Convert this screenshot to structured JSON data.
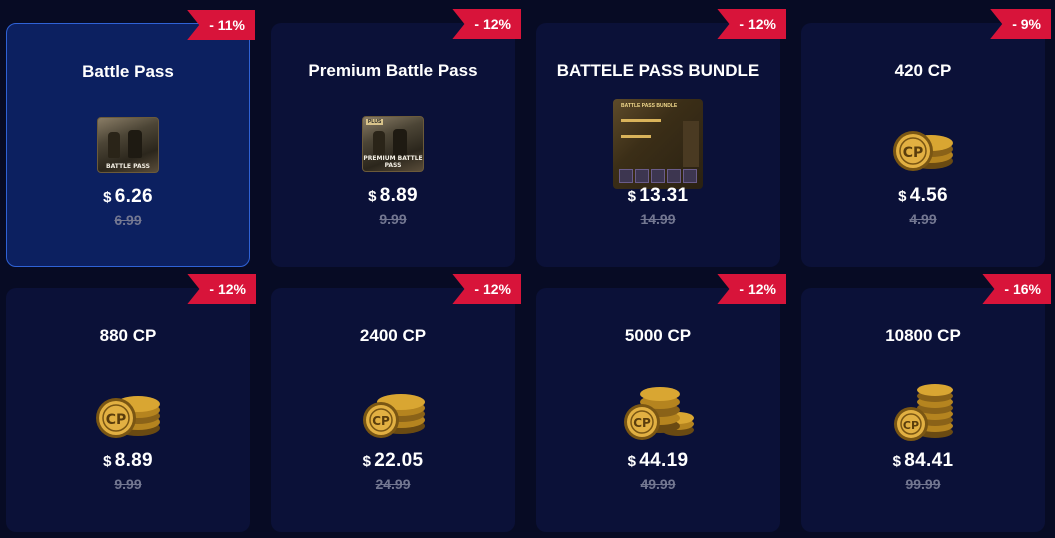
{
  "products": [
    {
      "title": "Battle Pass",
      "discount": "- 11%",
      "currency": "$",
      "price": "6.26",
      "old_price": "6.99",
      "icon": "battle-pass-image",
      "selected": true,
      "thumb_caption": "BATTLE PASS"
    },
    {
      "title": "Premium Battle Pass",
      "discount": "- 12%",
      "currency": "$",
      "price": "8.89",
      "old_price": "9.99",
      "icon": "premium-battle-pass-image",
      "selected": false,
      "thumb_caption": "PREMIUM BATTLE PASS",
      "thumb_tag": "PLUS"
    },
    {
      "title": "BATTELE PASS BUNDLE",
      "discount": "- 12%",
      "currency": "$",
      "price": "13.31",
      "old_price": "14.99",
      "icon": "battle-pass-bundle-image",
      "selected": false,
      "thumb_caption": "BATTLE PASS BUNDLE"
    },
    {
      "title": "420 CP",
      "discount": "- 9%",
      "currency": "$",
      "price": "4.56",
      "old_price": "4.99",
      "icon": "cp-coins-icon",
      "selected": false,
      "coin_label": "CP"
    },
    {
      "title": "880 CP",
      "discount": "- 12%",
      "currency": "$",
      "price": "8.89",
      "old_price": "9.99",
      "icon": "cp-coins-icon",
      "selected": false,
      "coin_label": "CP"
    },
    {
      "title": "2400 CP",
      "discount": "- 12%",
      "currency": "$",
      "price": "22.05",
      "old_price": "24.99",
      "icon": "cp-coins-icon",
      "selected": false,
      "coin_label": "CP"
    },
    {
      "title": "5000 CP",
      "discount": "- 12%",
      "currency": "$",
      "price": "44.19",
      "old_price": "49.99",
      "icon": "cp-coins-icon",
      "selected": false,
      "coin_label": "CP"
    },
    {
      "title": "10800 CP",
      "discount": "- 16%",
      "currency": "$",
      "price": "84.41",
      "old_price": "99.99",
      "icon": "cp-coins-icon",
      "selected": false,
      "coin_label": "CP"
    }
  ],
  "colors": {
    "background": "#070b24",
    "card": "#0b1138",
    "card_selected": "#0c2060",
    "selected_border": "#2f62d6",
    "badge": "#d8143a",
    "old_price": "#737791",
    "coin_gold": "#d9a632"
  }
}
